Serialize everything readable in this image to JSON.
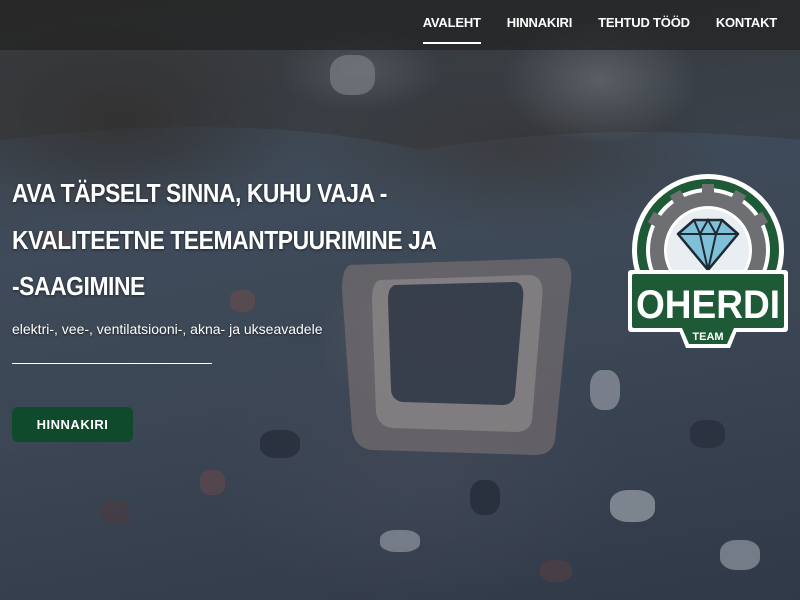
{
  "nav": {
    "items": [
      {
        "label": "AVALEHT",
        "active": true
      },
      {
        "label": "HINNAKIRI",
        "active": false
      },
      {
        "label": "TEHTUD TÖÖD",
        "active": false
      },
      {
        "label": "KONTAKT",
        "active": false
      }
    ]
  },
  "hero": {
    "headline_lines": [
      "AVA TÄPSELT SINNA, KUHU VAJA -",
      "KVALITEETNE TEEMANTPUURIMINE JA",
      "-SAAGIMINE"
    ],
    "subtext": "elektri-, vee-, ventilatsiooni-, akna- ja ukseavadele",
    "cta_label": "HINNAKIRI"
  },
  "logo": {
    "text": "OHERDI",
    "subtext": "TEAM",
    "colors": {
      "ring": "#1f5a36",
      "steel": "#6d6f72",
      "diamond": "#7fc0d8"
    }
  },
  "colors": {
    "button": "#0f4a2c",
    "navbar": "#232323"
  }
}
